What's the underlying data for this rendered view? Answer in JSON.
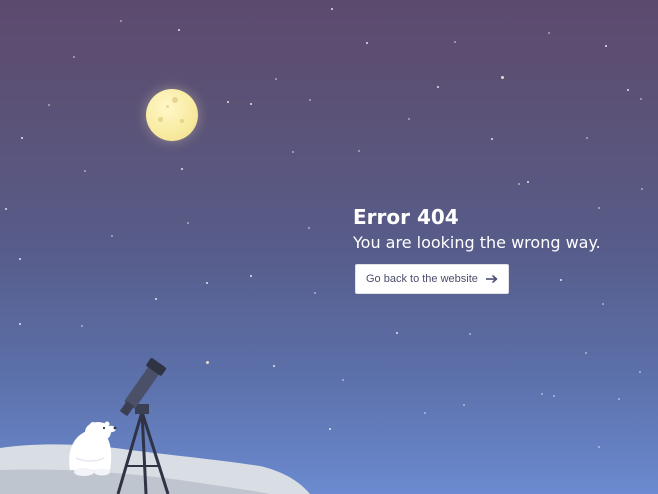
{
  "error": {
    "title": "Error 404",
    "message": "You are looking the wrong way.",
    "back_button_label": "Go back to the website"
  },
  "icons": {
    "back_button": "arrow-right-icon",
    "scene": [
      "moon-icon",
      "telescope-icon",
      "polar-bear-icon"
    ]
  },
  "colors": {
    "sky_top": "#5c4a6e",
    "sky_bottom": "#6b8ad0",
    "moon": "#f8eaa0",
    "button_background": "#ffffff",
    "button_text": "#4b4d6e"
  }
}
